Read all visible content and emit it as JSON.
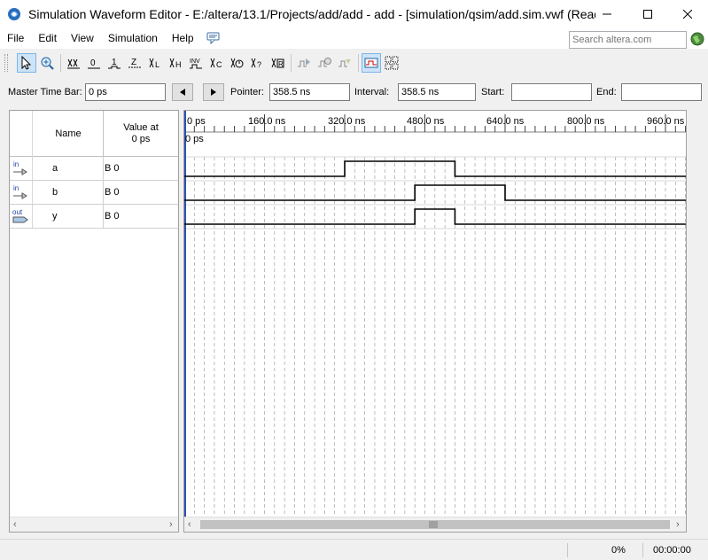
{
  "window": {
    "title": "Simulation Waveform Editor - E:/altera/13.1/Projects/add/add - add - [simulation/qsim/add.sim.vwf (Read-...",
    "minimize": "—",
    "maximize": "☐",
    "close": "✕"
  },
  "menu": {
    "items": [
      "File",
      "Edit",
      "View",
      "Simulation",
      "Help"
    ],
    "search_placeholder": "Search altera.com"
  },
  "fields": {
    "master_time_bar_label": "Master Time Bar:",
    "master_time_bar_value": "0 ps",
    "pointer_label": "Pointer:",
    "pointer_value": "358.5 ns",
    "interval_label": "Interval:",
    "interval_value": "358.5 ns",
    "start_label": "Start:",
    "start_value": "",
    "end_label": "End:",
    "end_value": ""
  },
  "signal_table": {
    "header_name": "Name",
    "header_value_line1": "Value at",
    "header_value_line2": "0 ps",
    "signals": [
      {
        "type_tag": "in",
        "name": "a",
        "value": "B 0",
        "transitions_ns": [
          320.0,
          540.0
        ]
      },
      {
        "type_tag": "in",
        "name": "b",
        "value": "B 0",
        "transitions_ns": [
          460.0,
          640.0
        ]
      },
      {
        "type_tag": "out",
        "name": "y",
        "value": "B 0",
        "transitions_ns": [
          460.0,
          540.0
        ]
      }
    ]
  },
  "timescale": {
    "labels": [
      "0 ps",
      "160.0 ns",
      "320.0 ns",
      "480.0 ns",
      "640.0 ns",
      "800.0 ns",
      "960.0 ns"
    ],
    "cursor_label": "0 ps",
    "colors": {
      "cursor": "#3050b0",
      "wave": "#000000",
      "grid": "#a0a0a0"
    }
  },
  "status": {
    "progress": "0%",
    "elapsed": "00:00:00"
  }
}
